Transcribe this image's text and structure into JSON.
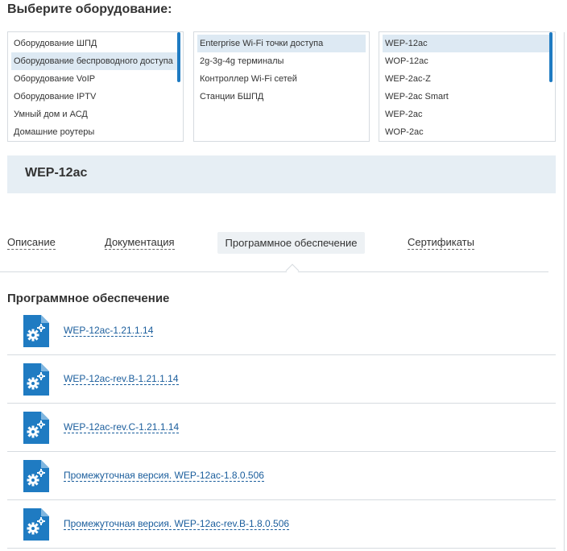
{
  "heading": "Выберите оборудование:",
  "categories": {
    "items": [
      {
        "label": "Оборудование ШПД",
        "selected": false
      },
      {
        "label": "Оборудование беспроводного доступа",
        "selected": true
      },
      {
        "label": "Оборудование VoIP",
        "selected": false
      },
      {
        "label": "Оборудование IPTV",
        "selected": false
      },
      {
        "label": "Умный дом и АСД",
        "selected": false
      },
      {
        "label": "Домашние роутеры",
        "selected": false
      }
    ]
  },
  "subcategories": {
    "items": [
      {
        "label": "Enterprise Wi-Fi точки доступа",
        "selected": true
      },
      {
        "label": "2g-3g-4g терминалы",
        "selected": false
      },
      {
        "label": "Контроллер Wi-Fi сетей",
        "selected": false
      },
      {
        "label": "Станции БШПД",
        "selected": false
      }
    ]
  },
  "models": {
    "items": [
      {
        "label": "WEP-12ac",
        "selected": true
      },
      {
        "label": "WOP-12ac",
        "selected": false
      },
      {
        "label": "WEP-2ac-Z",
        "selected": false
      },
      {
        "label": "WEP-2ac Smart",
        "selected": false
      },
      {
        "label": "WEP-2ac",
        "selected": false
      },
      {
        "label": "WOP-2ac",
        "selected": false
      }
    ]
  },
  "selected_model": "WEP-12ac",
  "tabs": [
    {
      "label": "Описание",
      "active": false
    },
    {
      "label": "Документация",
      "active": false
    },
    {
      "label": "Программное обеспечение",
      "active": true
    },
    {
      "label": "Сертификаты",
      "active": false
    }
  ],
  "section_title": "Программное обеспечение",
  "downloads": [
    {
      "label": "WEP-12ac-1.21.1.14",
      "icon": "software-file-icon"
    },
    {
      "label": "WEP-12ac-rev.B-1.21.1.14",
      "icon": "software-file-icon"
    },
    {
      "label": "WEP-12ac-rev.C-1.21.1.14",
      "icon": "software-file-icon"
    },
    {
      "label": "Промежуточная версия. WEP-12ac-1.8.0.506",
      "icon": "software-file-icon"
    },
    {
      "label": "Промежуточная версия. WEP-12ac-rev.B-1.8.0.506",
      "icon": "software-file-icon"
    }
  ],
  "colors": {
    "accent": "#1f7bc2",
    "link": "#1a5d9c",
    "selected_item_bg": "#dde9f3",
    "banner_bg": "#e6eef4"
  }
}
